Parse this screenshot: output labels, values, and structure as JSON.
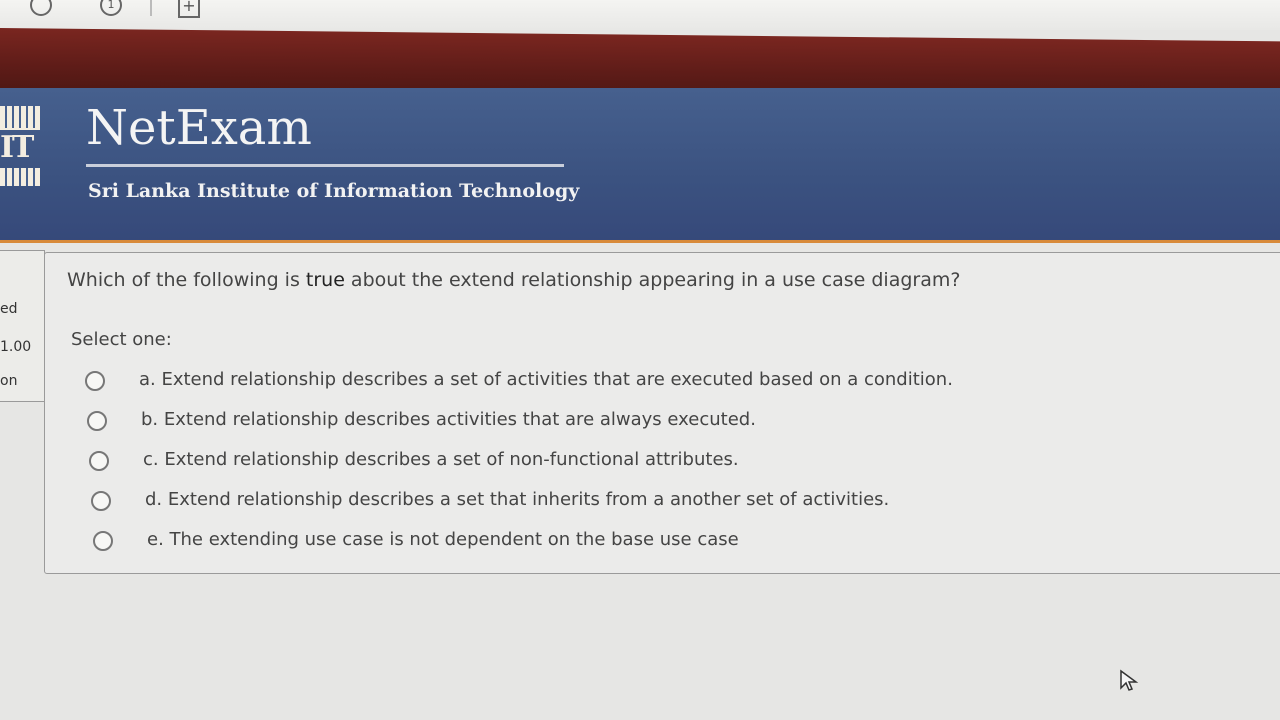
{
  "header": {
    "title": "NetExam",
    "subtitle": "Sri Lanka Institute of Information Technology",
    "logo_text": "IT"
  },
  "sidebar": {
    "state_fragment": "ed",
    "mark_fragment": "1.00",
    "flag_fragment": "on"
  },
  "question": {
    "text_before": "Which of the following is ",
    "text_highlight": "true",
    "text_after": " about the extend relationship appearing in a use case diagram?",
    "prompt": "Select one:",
    "options": [
      {
        "label": "a. Extend relationship describes a set of activities that are executed based on a condition."
      },
      {
        "label": "b. Extend relationship describes activities that are always executed."
      },
      {
        "label": "c. Extend relationship describes a set of non-functional attributes."
      },
      {
        "label": "d. Extend relationship describes a set that inherits from a another set of activities."
      },
      {
        "label": "e. The extending use case is not dependent on the base use case"
      }
    ]
  },
  "colors": {
    "banner": "#3b5280",
    "top_band": "#5e1c18",
    "accent_rule": "#d88a3a"
  }
}
